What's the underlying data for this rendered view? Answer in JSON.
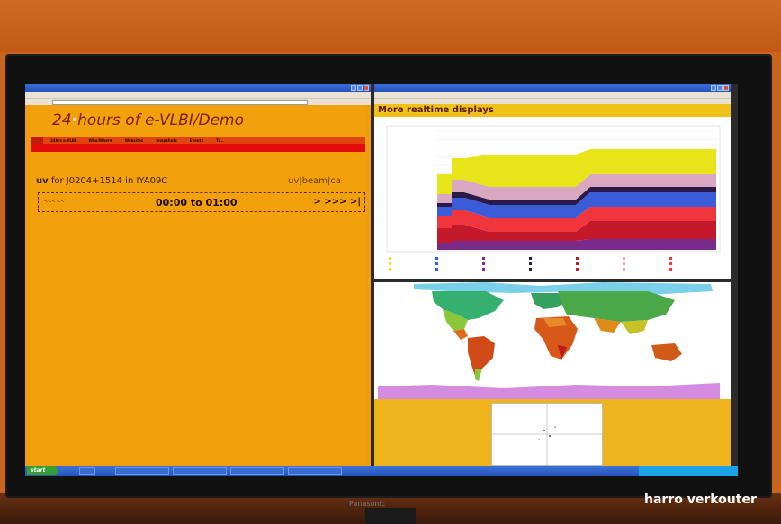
{
  "left_window": {
    "title_text": "",
    "page_title_prefix": "24",
    "page_title_suffix": "hours of e-VLBI/Demo",
    "nav_items": [
      "",
      "24hrs e-VLBI",
      "Who/Where",
      "Websites",
      "Snapshots",
      "Events",
      "Ti..."
    ],
    "source_prefix": "uv",
    "source_text": "for J0204+1514 in IYA09C",
    "beam_text": "uv|beam|ca",
    "time_prev": "<<< <<",
    "time_range": "00:00 to 01:00",
    "time_next": "> >>> >|"
  },
  "right_top_window": {
    "section_title": "More realtime displays",
    "colors": [
      "#e8e41a",
      "#d9a8c0",
      "#2a1a4a",
      "#3b5cd8",
      "#f0363c",
      "#c4192a",
      "#7a2a8a"
    ]
  },
  "right_bottom_window": {},
  "taskbar": {
    "start_label": "start"
  },
  "photo_credit": "harro verkouter",
  "brand": "Panasonic"
}
